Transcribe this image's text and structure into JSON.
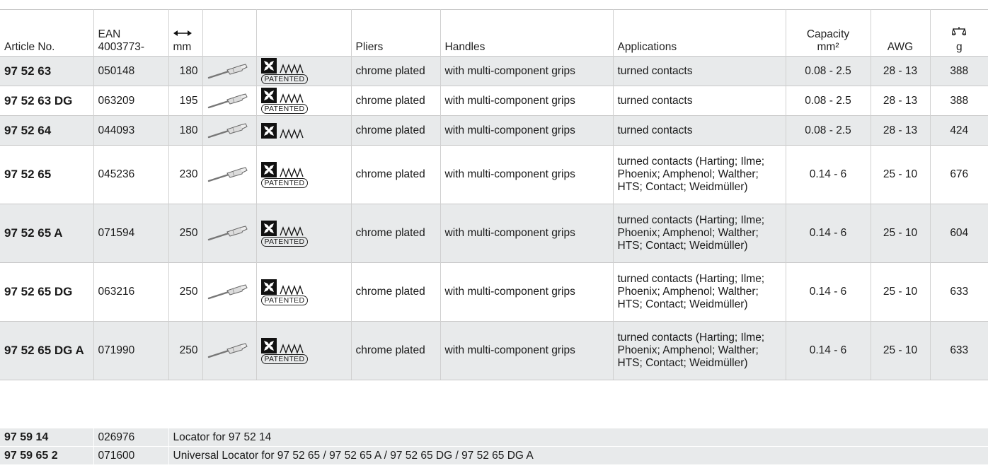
{
  "headers": {
    "article_no": "Article No.",
    "ean_line1": "EAN",
    "ean_line2": "4003773-",
    "length_unit": "mm",
    "pliers": "Pliers",
    "handles": "Handles",
    "applications": "Applications",
    "capacity_line1": "Capacity",
    "capacity_line2": "mm²",
    "awg": "AWG",
    "weight_unit": "g"
  },
  "patented_label": "PATENTED",
  "rows": [
    {
      "article": "97 52 63",
      "ean": "050148",
      "length": "180",
      "patented": true,
      "pliers": "chrome plated",
      "handles": "with multi-component grips",
      "applications": "turned contacts",
      "capacity": "0.08 - 2.5",
      "awg": "28 - 13",
      "weight": "388"
    },
    {
      "article": "97 52 63 DG",
      "ean": "063209",
      "length": "195",
      "patented": true,
      "pliers": "chrome plated",
      "handles": "with multi-component grips",
      "applications": "turned contacts",
      "capacity": "0.08 - 2.5",
      "awg": "28 - 13",
      "weight": "388"
    },
    {
      "article": "97 52 64",
      "ean": "044093",
      "length": "180",
      "patented": false,
      "pliers": "chrome plated",
      "handles": "with multi-component grips",
      "applications": "turned contacts",
      "capacity": "0.08 - 2.5",
      "awg": "28 - 13",
      "weight": "424"
    },
    {
      "article": "97 52 65",
      "ean": "045236",
      "length": "230",
      "patented": true,
      "pliers": "chrome plated",
      "handles": "with multi-component grips",
      "applications": "turned contacts (Harting; Ilme; Phoenix; Amphenol; Walther; HTS; Contact; Weidmüller)",
      "capacity": "0.14 - 6",
      "awg": "25 - 10",
      "weight": "676"
    },
    {
      "article": "97 52 65 A",
      "ean": "071594",
      "length": "250",
      "patented": true,
      "pliers": "chrome plated",
      "handles": "with multi-component grips",
      "applications": "turned contacts (Harting; Ilme; Phoenix; Amphenol; Walther; HTS; Contact; Weidmüller)",
      "capacity": "0.14 - 6",
      "awg": "25 - 10",
      "weight": "604"
    },
    {
      "article": "97 52 65 DG",
      "ean": "063216",
      "length": "250",
      "patented": true,
      "pliers": "chrome plated",
      "handles": "with multi-component grips",
      "applications": "turned contacts (Harting; Ilme; Phoenix; Amphenol; Walther; HTS; Contact; Weidmüller)",
      "capacity": "0.14 - 6",
      "awg": "25 - 10",
      "weight": "633"
    },
    {
      "article": "97 52 65 DG A",
      "ean": "071990",
      "length": "250",
      "patented": true,
      "pliers": "chrome plated",
      "handles": "with multi-component grips",
      "applications": "turned contacts (Harting; Ilme; Phoenix; Amphenol; Walther; HTS; Contact; Weidmüller)",
      "capacity": "0.14 - 6",
      "awg": "25 - 10",
      "weight": "633"
    }
  ],
  "accessories": [
    {
      "article": "97 59 14",
      "ean": "026976",
      "description": "Locator for 97 52 14"
    },
    {
      "article": "97 59 65 2",
      "ean": "071600",
      "description": "Universal Locator for 97 52 65 / 97 52 65 A / 97 52 65 DG / 97 52 65 DG A"
    }
  ],
  "icons": {
    "length": "double-arrow-icon",
    "weight": "scale-icon",
    "tool": "turned-contact-icon",
    "cross": "square-cross-icon",
    "wave": "zigzag-icon"
  }
}
